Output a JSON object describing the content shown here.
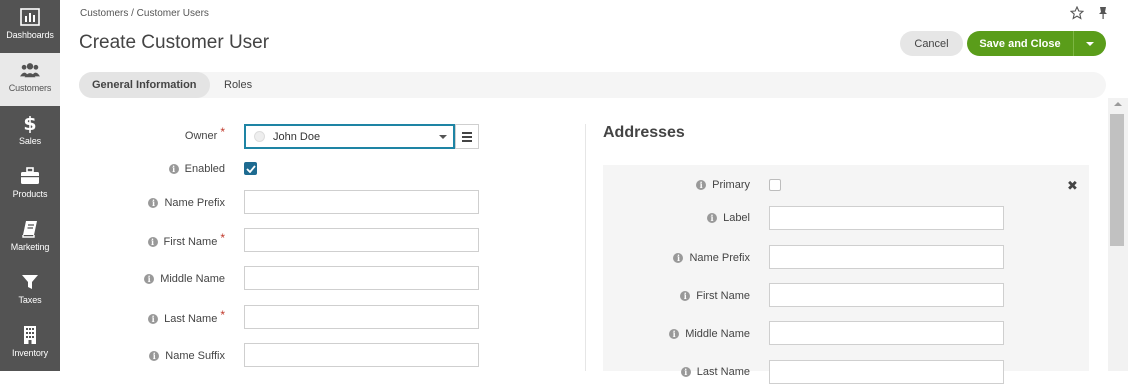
{
  "sidebar": {
    "items": [
      {
        "label": "Dashboards",
        "icon": "bar-chart-icon"
      },
      {
        "label": "Customers",
        "icon": "users-icon",
        "active": true
      },
      {
        "label": "Sales",
        "icon": "dollar-icon"
      },
      {
        "label": "Products",
        "icon": "briefcase-icon"
      },
      {
        "label": "Marketing",
        "icon": "book-icon"
      },
      {
        "label": "Taxes",
        "icon": "filter-icon"
      },
      {
        "label": "Inventory",
        "icon": "building-icon"
      }
    ]
  },
  "header": {
    "breadcrumb": "Customers / Customer Users",
    "title": "Create Customer User",
    "cancel_label": "Cancel",
    "save_label": "Save and Close"
  },
  "tabs": [
    {
      "label": "General Information",
      "active": true
    },
    {
      "label": "Roles",
      "active": false
    }
  ],
  "form": {
    "owner": {
      "label": "Owner",
      "value": "John Doe"
    },
    "enabled": {
      "label": "Enabled",
      "checked": true
    },
    "name_prefix": {
      "label": "Name Prefix",
      "value": ""
    },
    "first_name": {
      "label": "First Name",
      "value": ""
    },
    "middle_name": {
      "label": "Middle Name",
      "value": ""
    },
    "last_name": {
      "label": "Last Name",
      "value": ""
    },
    "name_suffix": {
      "label": "Name Suffix",
      "value": ""
    }
  },
  "addresses": {
    "title": "Addresses",
    "primary": {
      "label": "Primary",
      "checked": false
    },
    "label": {
      "label": "Label",
      "value": ""
    },
    "name_prefix": {
      "label": "Name Prefix",
      "value": ""
    },
    "first_name": {
      "label": "First Name",
      "value": ""
    },
    "middle_name": {
      "label": "Middle Name",
      "value": ""
    },
    "last_name": {
      "label": "Last Name",
      "value": ""
    }
  },
  "colors": {
    "sidebar_bg": "#535353",
    "accent_green": "#5a9d1a",
    "focus_blue": "#1e84a4",
    "required_red": "#c0392b"
  }
}
